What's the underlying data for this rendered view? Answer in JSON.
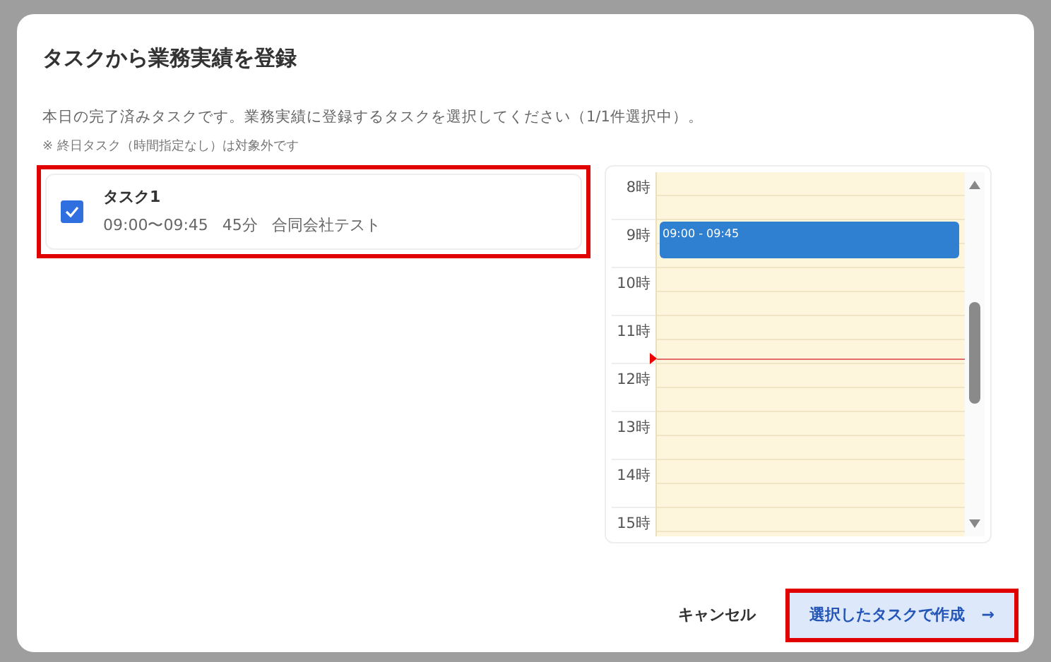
{
  "dialog": {
    "title": "タスクから業務実績を登録",
    "description": "本日の完了済みタスクです。業務実績に登録するタスクを選択してください（1/1件選択中）。",
    "note": "※ 終日タスク（時間指定なし）は対象外です"
  },
  "tasks": [
    {
      "title": "タスク1",
      "time": "09:00〜09:45",
      "duration": "45分",
      "client": "合同会社テスト",
      "checked": true,
      "highlighted": true
    }
  ],
  "calendar": {
    "hours": [
      "8時",
      "9時",
      "10時",
      "11時",
      "12時",
      "13時",
      "14時",
      "15時"
    ],
    "events": [
      {
        "label": "09:00 - 09:45"
      }
    ],
    "current_time": {
      "level": 0.47
    }
  },
  "buttons": [
    {
      "label": "キャンセル",
      "kind": "text",
      "highlighted": false
    },
    {
      "label": "選択したタスクで作成",
      "icon": "→",
      "kind": "primary",
      "highlighted": true
    }
  ]
}
